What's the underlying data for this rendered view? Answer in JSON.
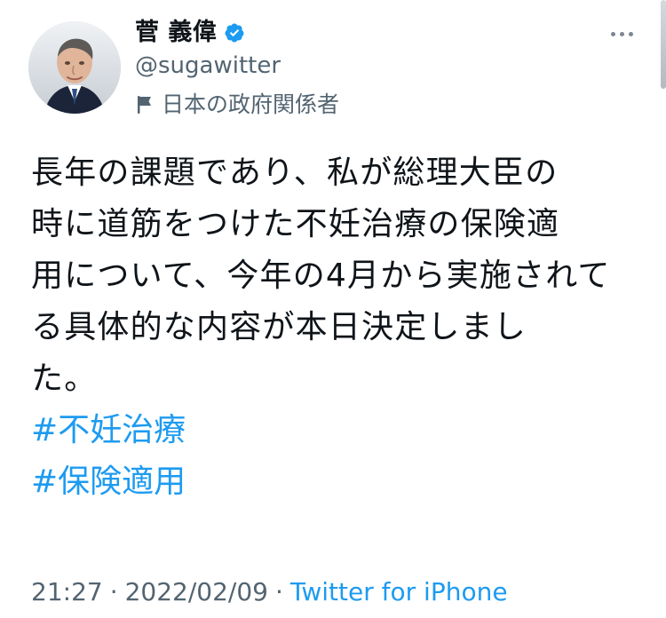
{
  "colors": {
    "primary_text": "#0f1419",
    "secondary_text": "#536471",
    "link": "#1d9bf0",
    "verified": "#1d9bf0"
  },
  "header": {
    "name": "菅 義偉",
    "handle": "@sugawitter",
    "affiliation": "日本の政府関係者",
    "icons": {
      "verified": "verified-icon",
      "affiliation": "flag-icon",
      "more": "more-icon"
    }
  },
  "tweet": {
    "lines": [
      "長年の課題であり、私が総理大臣の",
      "時に道筋をつけた不妊治療の保険適",
      "用について、今年の4月から実施されて",
      "る具体的な内容が本日決定しまし",
      "た。"
    ],
    "hashtags": [
      "#不妊治療",
      "#保険適用"
    ]
  },
  "meta": {
    "time": "21:27",
    "separator_1": "·",
    "date": "2022/02/09",
    "separator_2": "·",
    "source": "Twitter for iPhone"
  }
}
